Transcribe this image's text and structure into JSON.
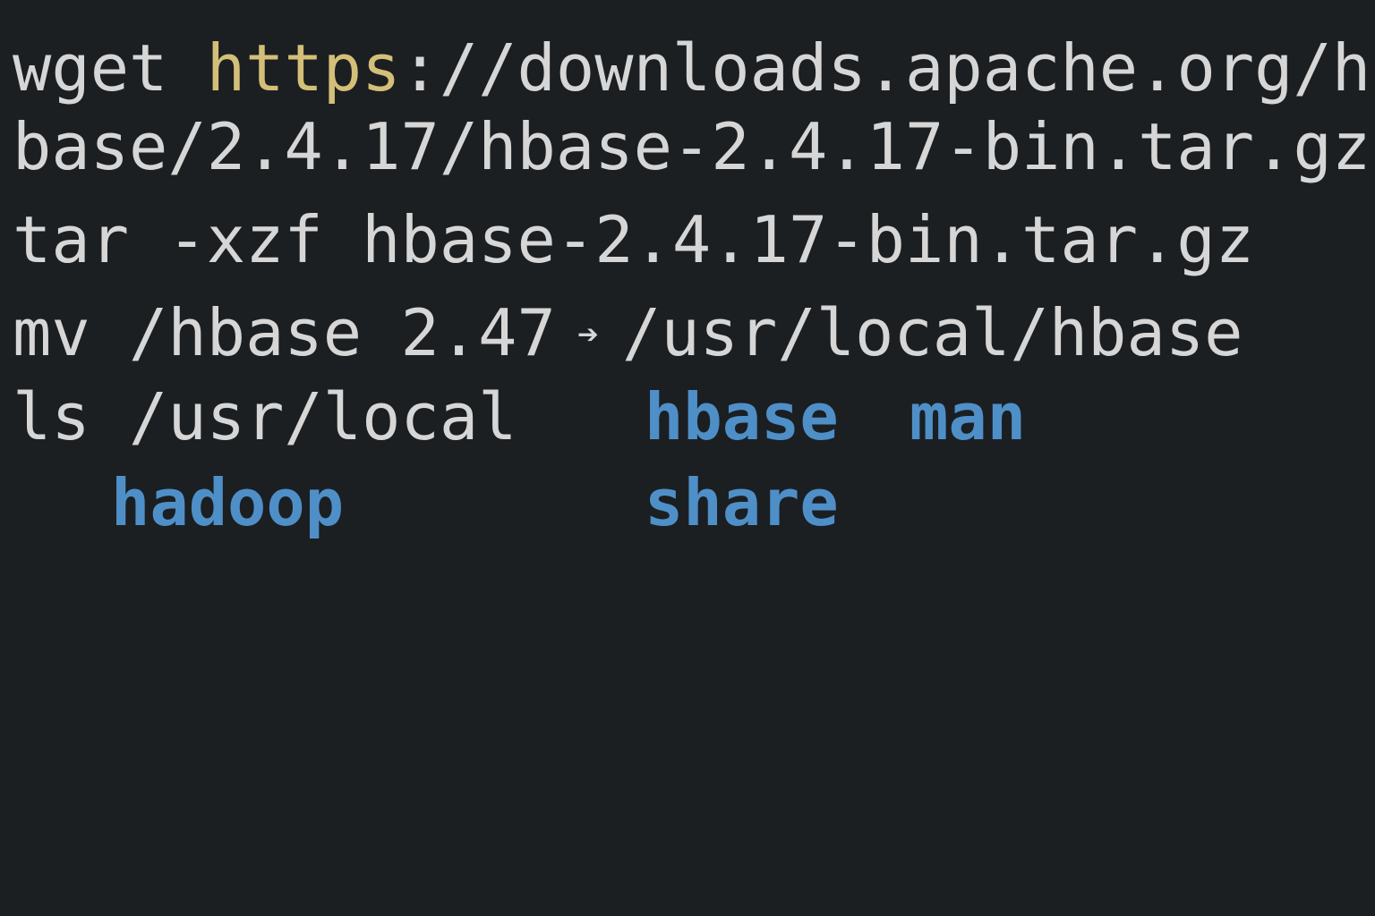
{
  "commands": {
    "wget": {
      "cmd": "wget ",
      "scheme": "https",
      "rest_line1": "://downloads.apache.org/h-",
      "rest_line2": "base/2.4.17/hbase-2.4.17-bin.tar.gz"
    },
    "tar": {
      "text": "tar -xzf hbase-2.4.17-bin.tar.gz"
    },
    "mv": {
      "source": "mv /hbase 2.47",
      "arrow_icon": "right-arrow-icon",
      "arrow_glyph": "➔",
      "dest": "/usr/local/hbase"
    },
    "ls": {
      "text": "ls /usr/local"
    }
  },
  "ls_output": {
    "entries": [
      "hbase",
      "man",
      "hadoop",
      "share"
    ]
  },
  "colors": {
    "background": "#1b1f22",
    "text": "#d6d6d6",
    "url_scheme": "#d4bf78",
    "directory": "#4f8fc8"
  }
}
